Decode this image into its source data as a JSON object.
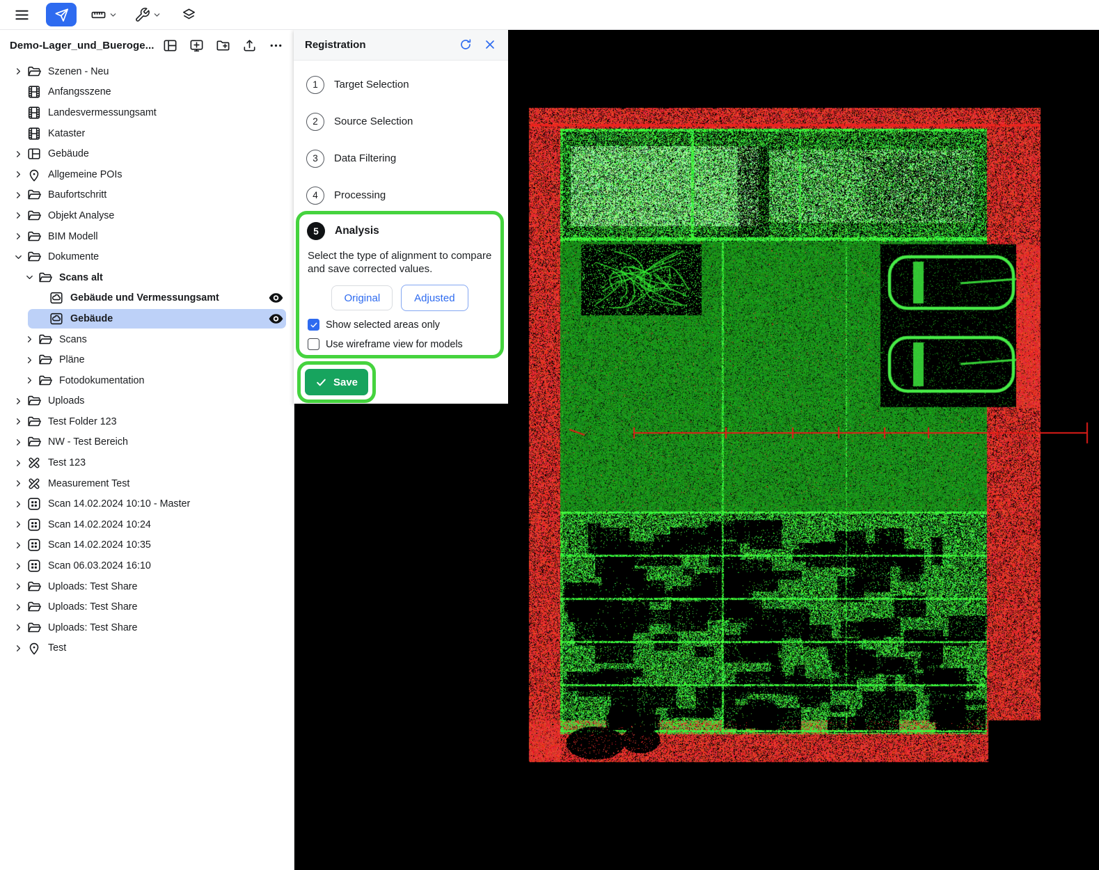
{
  "toolbar": {
    "tools": [
      {
        "name": "menu"
      },
      {
        "name": "select",
        "active": true
      },
      {
        "name": "measure",
        "has_dropdown": true
      },
      {
        "name": "utilities",
        "has_dropdown": true
      },
      {
        "name": "layers"
      }
    ]
  },
  "sidebar": {
    "title": "Demo-Lager_und_Bueroge...",
    "actions": [
      "layout-view",
      "add-scene",
      "add-folder",
      "upload",
      "more"
    ],
    "tree": [
      {
        "label": "Szenen - Neu",
        "icon": "folder",
        "level": 0,
        "chevron": "right"
      },
      {
        "label": "Anfangsszene",
        "icon": "film",
        "level": 0,
        "chevron": null
      },
      {
        "label": "Landesvermessungsamt",
        "icon": "film",
        "level": 0,
        "chevron": null
      },
      {
        "label": "Kataster",
        "icon": "film",
        "level": 0,
        "chevron": null
      },
      {
        "label": "Gebäude",
        "icon": "table",
        "level": 0,
        "chevron": "right"
      },
      {
        "label": "Allgemeine POIs",
        "icon": "pin",
        "level": 0,
        "chevron": "right"
      },
      {
        "label": "Baufortschritt",
        "icon": "folder",
        "level": 0,
        "chevron": "right"
      },
      {
        "label": "Objekt Analyse",
        "icon": "folder",
        "level": 0,
        "chevron": "right"
      },
      {
        "label": "BIM Modell",
        "icon": "folder",
        "level": 0,
        "chevron": "right"
      },
      {
        "label": "Dokumente",
        "icon": "folder",
        "level": 0,
        "chevron": "down"
      },
      {
        "label": "Scans alt",
        "icon": "folder",
        "level": 1,
        "chevron": "down",
        "bold": true
      },
      {
        "label": "Gebäude und Vermessungsamt",
        "icon": "cloud",
        "level": 2,
        "chevron": null,
        "eye": true,
        "bold": true
      },
      {
        "label": "Gebäude",
        "icon": "cloud",
        "level": 2,
        "chevron": null,
        "eye": true,
        "bold": true,
        "selected": true
      },
      {
        "label": "Scans",
        "icon": "folder",
        "level": 1,
        "chevron": "right"
      },
      {
        "label": "Pläne",
        "icon": "folder",
        "level": 1,
        "chevron": "right"
      },
      {
        "label": "Fotodokumentation",
        "icon": "folder",
        "level": 1,
        "chevron": "right"
      },
      {
        "label": "Uploads",
        "icon": "folder",
        "level": 0,
        "chevron": "right"
      },
      {
        "label": "Test Folder 123",
        "icon": "folder",
        "level": 0,
        "chevron": "right"
      },
      {
        "label": "NW - Test Bereich",
        "icon": "folder",
        "level": 0,
        "chevron": "right"
      },
      {
        "label": "Test 123",
        "icon": "tools",
        "level": 0,
        "chevron": "right"
      },
      {
        "label": "Measurement Test",
        "icon": "tools",
        "level": 0,
        "chevron": "right"
      },
      {
        "label": "Scan 14.02.2024 10:10 - Master",
        "icon": "scan",
        "level": 0,
        "chevron": "right"
      },
      {
        "label": "Scan 14.02.2024 10:24",
        "icon": "scan",
        "level": 0,
        "chevron": "right"
      },
      {
        "label": "Scan 14.02.2024 10:35",
        "icon": "scan",
        "level": 0,
        "chevron": "right"
      },
      {
        "label": "Scan 06.03.2024 16:10",
        "icon": "scan",
        "level": 0,
        "chevron": "right"
      },
      {
        "label": "Uploads: Test Share",
        "icon": "folder",
        "level": 0,
        "chevron": "right"
      },
      {
        "label": "Uploads: Test Share",
        "icon": "folder",
        "level": 0,
        "chevron": "right"
      },
      {
        "label": "Uploads: Test Share",
        "icon": "folder",
        "level": 0,
        "chevron": "right"
      },
      {
        "label": "Test",
        "icon": "pin",
        "level": 0,
        "chevron": "right"
      }
    ]
  },
  "panel": {
    "title": "Registration",
    "steps": [
      {
        "num": "1",
        "label": "Target Selection"
      },
      {
        "num": "2",
        "label": "Source Selection"
      },
      {
        "num": "3",
        "label": "Data Filtering"
      },
      {
        "num": "4",
        "label": "Processing"
      },
      {
        "num": "5",
        "label": "Analysis",
        "active": true
      }
    ],
    "analysis": {
      "description": "Select the type of alignment to compare and save corrected values.",
      "buttons": [
        {
          "label": "Original",
          "selected": false
        },
        {
          "label": "Adjusted",
          "selected": true
        }
      ],
      "checkboxes": [
        {
          "label": "Show selected areas only",
          "checked": true
        },
        {
          "label": "Use wireframe view for models",
          "checked": false
        }
      ]
    },
    "save_label": "Save"
  },
  "colors": {
    "primary_blue": "#2e6bf0",
    "selected_row": "#bdd1f8",
    "annotation_green": "#45d33e",
    "save_green": "#17a45e",
    "cloud_red": "#e03028",
    "cloud_bright_green": "#36e436",
    "cloud_dark_green": "#1e8c1e",
    "viewport_background": "#000000"
  }
}
